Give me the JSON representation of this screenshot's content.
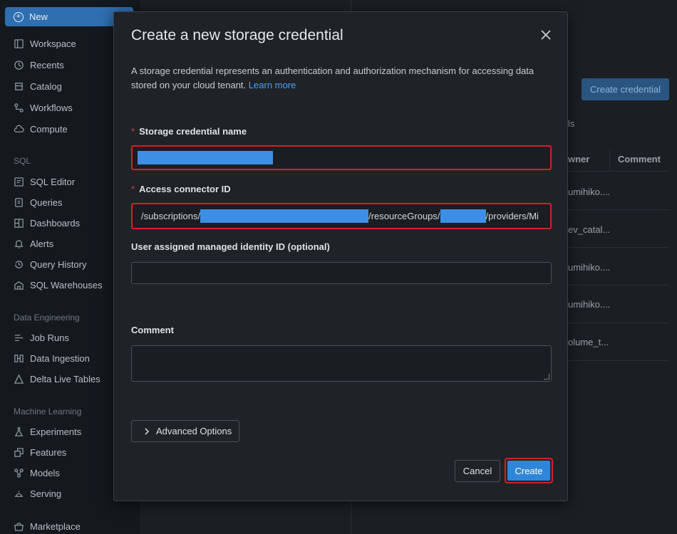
{
  "sidebar": {
    "new_label": "New",
    "items_main": [
      {
        "label": "Workspace",
        "icon": "workspace-icon"
      },
      {
        "label": "Recents",
        "icon": "clock-icon"
      },
      {
        "label": "Catalog",
        "icon": "catalog-icon"
      },
      {
        "label": "Workflows",
        "icon": "workflows-icon"
      },
      {
        "label": "Compute",
        "icon": "cloud-icon"
      }
    ],
    "sql_section": "SQL",
    "items_sql": [
      {
        "label": "SQL Editor",
        "icon": "sql-editor-icon"
      },
      {
        "label": "Queries",
        "icon": "queries-icon"
      },
      {
        "label": "Dashboards",
        "icon": "dashboards-icon"
      },
      {
        "label": "Alerts",
        "icon": "bell-icon"
      },
      {
        "label": "Query History",
        "icon": "history-icon"
      },
      {
        "label": "SQL Warehouses",
        "icon": "warehouse-icon"
      }
    ],
    "de_section": "Data Engineering",
    "items_de": [
      {
        "label": "Job Runs",
        "icon": "job-runs-icon"
      },
      {
        "label": "Data Ingestion",
        "icon": "ingestion-icon"
      },
      {
        "label": "Delta Live Tables",
        "icon": "delta-icon"
      }
    ],
    "ml_section": "Machine Learning",
    "items_ml": [
      {
        "label": "Experiments",
        "icon": "flask-icon"
      },
      {
        "label": "Features",
        "icon": "features-icon"
      },
      {
        "label": "Models",
        "icon": "models-icon"
      },
      {
        "label": "Serving",
        "icon": "serving-icon"
      }
    ],
    "marketplace": {
      "label": "Marketplace",
      "icon": "marketplace-icon"
    }
  },
  "background": {
    "create_credential": "Create credential",
    "section_fragment": "ls",
    "col_owner": "wner",
    "col_comment": "Comment",
    "rows": [
      "umihiko....",
      "ev_catal...",
      "umihiko....",
      "umihiko....",
      "olume_t..."
    ]
  },
  "modal": {
    "title": "Create a new storage credential",
    "description": "A storage credential represents an authentication and authorization mechanism for accessing data stored on your cloud tenant.",
    "learn_more": "Learn more",
    "name_label": "Storage credential name",
    "connector_label": "Access connector ID",
    "connector_parts": [
      "/subscriptions/",
      "/resourceGroups/",
      "/providers/Mi"
    ],
    "identity_label": "User assigned managed identity ID (optional)",
    "comment_label": "Comment",
    "advanced_label": "Advanced Options",
    "cancel_label": "Cancel",
    "create_label": "Create",
    "required_mark": "*"
  }
}
